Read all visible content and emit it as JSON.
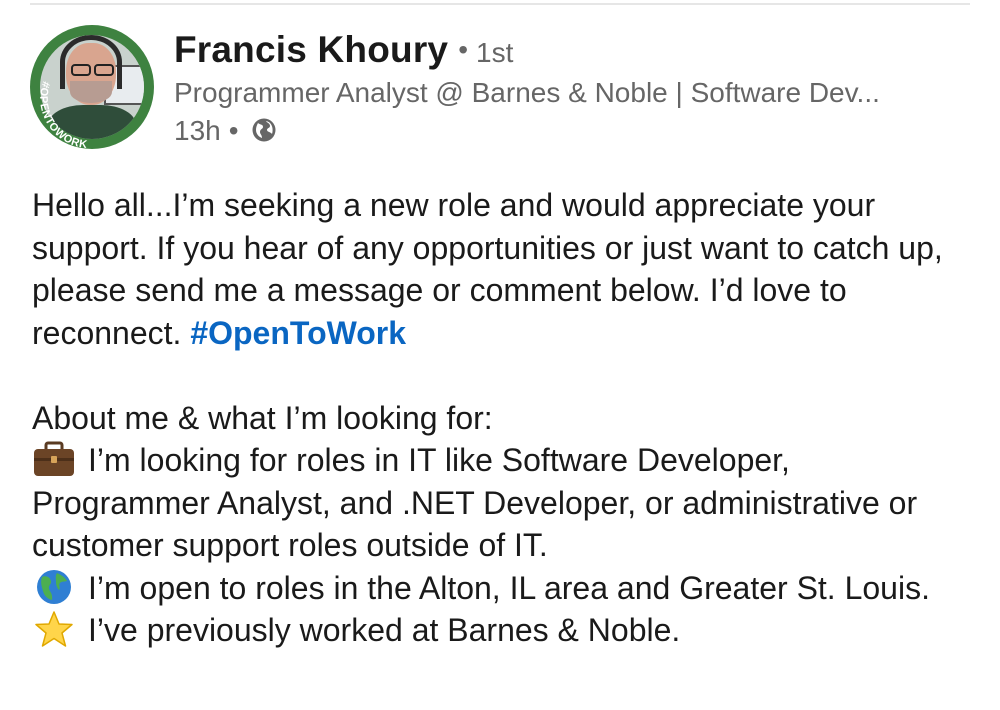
{
  "post": {
    "author": {
      "name": "Francis Khoury",
      "degree": "1st",
      "headline": "Programmer Analyst @ Barnes & Noble | Software Dev...",
      "time": "13h",
      "badge_text": "#OPENTOWORK"
    },
    "body": {
      "intro_text": "Hello all...I’m seeking a new role and would appreciate your support. If you hear of any opportunities or just want to catch up, please send me a message or comment below. I’d love to reconnect. ",
      "hashtag": "#OpenToWork",
      "about_heading": "About me & what I’m looking for:",
      "items": [
        {
          "icon": "briefcase-icon",
          "text": "I’m looking for roles in IT like Software Developer, Programmer Analyst, and .NET Developer, or administrative or customer support roles outside of IT."
        },
        {
          "icon": "globe-americas-icon",
          "text": "I’m open to roles in the Alton, IL area and Greater St. Louis."
        },
        {
          "icon": "star-icon",
          "text": "I’ve previously worked at Barnes & Noble."
        }
      ]
    }
  },
  "colors": {
    "hashtag": "#0a66c2",
    "open_to_work_ring": "#3e8240",
    "secondary_text": "#666666"
  }
}
